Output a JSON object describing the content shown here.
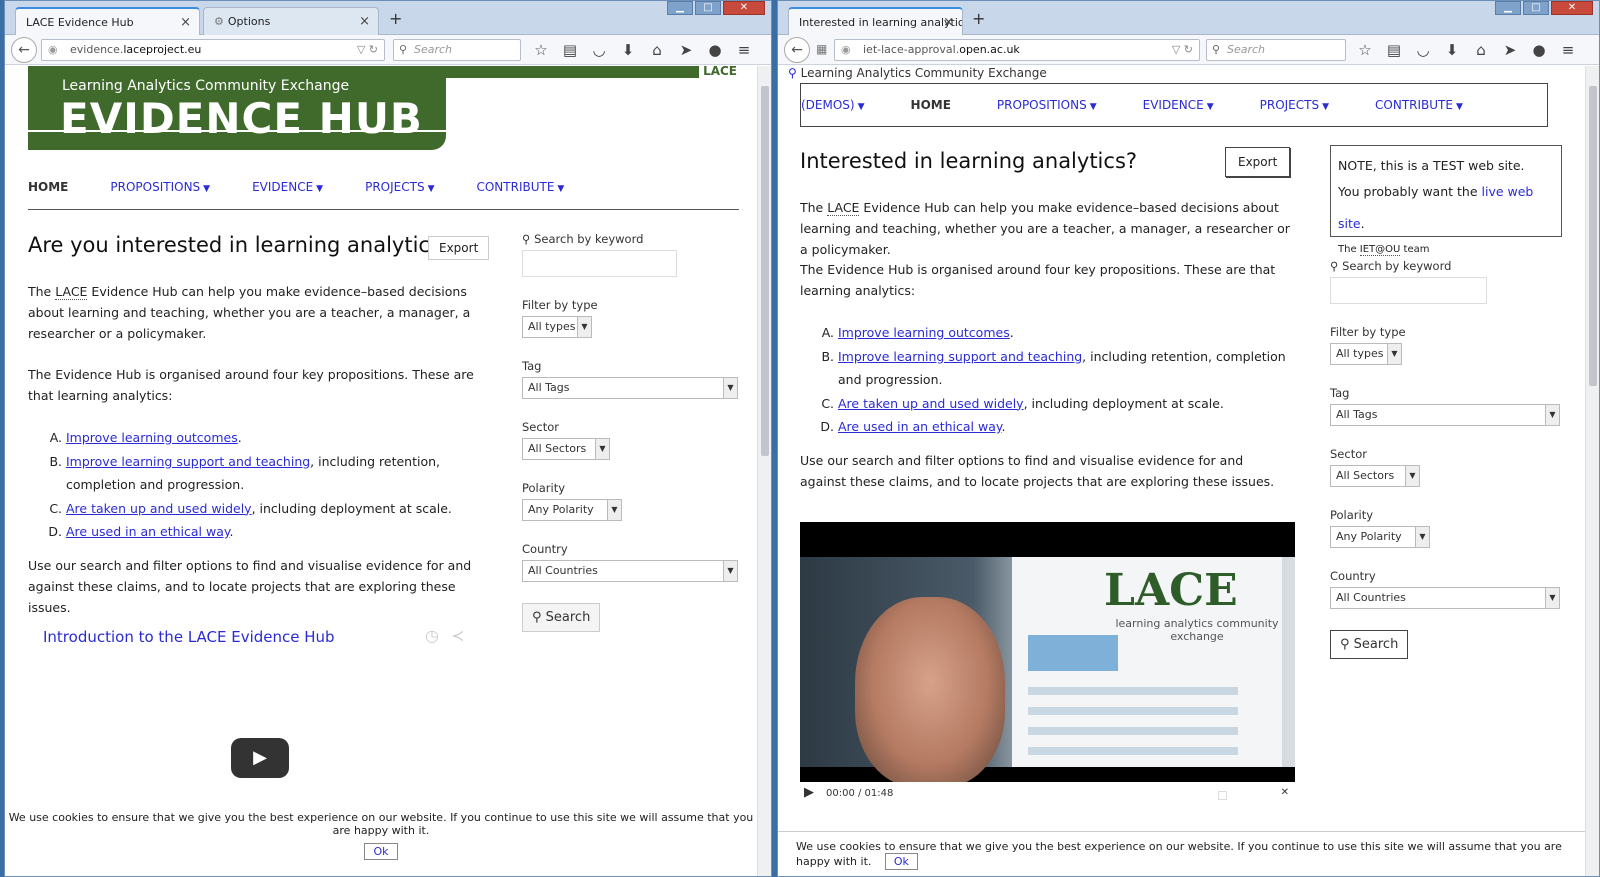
{
  "left": {
    "tabs": [
      {
        "label": "LACE Evidence Hub"
      },
      {
        "label": "Options"
      }
    ],
    "url": {
      "prefix": "evidence.",
      "domain": "laceproject.eu"
    },
    "search_placeholder": "Search",
    "logo": {
      "small": "Learning Analytics Community Exchange",
      "big": "EVIDENCE HUB",
      "mark": "LACE"
    },
    "nav": {
      "home": "HOME",
      "propositions": "PROPOSITIONS",
      "evidence": "EVIDENCE",
      "projects": "PROJECTS",
      "contribute": "CONTRIBUTE"
    },
    "title": "Are you interested in learning analytics?",
    "export": "Export",
    "intro": {
      "before": "The ",
      "abbr": "LACE",
      "after": " Evidence Hub can help you make evidence–based decisions about learning and teaching, whether you are a teacher, a manager, a researcher or a policymaker."
    },
    "organised": "The Evidence Hub is organised around four key propositions. These are that learning analytics:",
    "props": [
      {
        "link": "Improve learning outcomes",
        "rest": "."
      },
      {
        "link": "Improve learning support and teaching",
        "rest": ", including retention, completion and progression."
      },
      {
        "link": "Are taken up and used widely",
        "rest": ", including deployment at scale."
      },
      {
        "link": "Are used in an ethical way",
        "rest": "."
      }
    ],
    "use": "Use our search and filter options to find and visualise evidence for and against these claims, and to locate projects that are exploring these issues.",
    "sidebar": {
      "keyword": "Search by keyword",
      "filter_label": "Filter by type",
      "filter_value": "All types",
      "tag_label": "Tag",
      "tag_value": "All Tags",
      "sector_label": "Sector",
      "sector_value": "All Sectors",
      "polarity_label": "Polarity",
      "polarity_value": "Any Polarity",
      "country_label": "Country",
      "country_value": "All Countries",
      "search_btn": "Search"
    },
    "video_title": "Introduction to the LACE Evidence Hub",
    "cookie": "We use cookies to ensure that we give you the best experience on our website. If you continue to use this site we will assume that you are happy with it.",
    "ok": "Ok"
  },
  "right": {
    "tab": "Interested in learning analytics?...",
    "url": {
      "prefix": "iet-lace-approval.",
      "domain": "open.ac.uk"
    },
    "search_placeholder": "Search",
    "site_tag": "Learning Analytics Community Exchange",
    "nav": {
      "demos": "(DEMOS)",
      "home": "HOME",
      "propositions": "PROPOSITIONS",
      "evidence": "EVIDENCE",
      "projects": "PROJECTS",
      "contribute": "CONTRIBUTE"
    },
    "title": "Interested in learning analytics?",
    "export": "Export",
    "intro": {
      "before": "The ",
      "abbr": "LACE",
      "after": " Evidence Hub can help you make evidence–based decisions about learning and teaching, whether you are a teacher, a manager, a researcher or a policymaker."
    },
    "organised": "The Evidence Hub is organised around four key propositions. These are that learning analytics:",
    "props": [
      {
        "link": "Improve learning outcomes",
        "rest": "."
      },
      {
        "link": "Improve learning support and teaching",
        "rest": ", including retention, completion and progression."
      },
      {
        "link": "Are taken up and used widely",
        "rest": ", including deployment at scale."
      },
      {
        "link": "Are used in an ethical way",
        "rest": "."
      }
    ],
    "use": "Use our search and filter options to find and visualise evidence for and against these claims, and to locate projects that are exploring these issues.",
    "note": {
      "line1": "NOTE, this is a TEST web site.",
      "line2_before": "You probably want the ",
      "line2_link": "live web site",
      "line2_after": ".",
      "line3_before": "The ",
      "line3_abbr": "IET@OU",
      "line3_after": " team"
    },
    "sidebar": {
      "keyword": "Search by keyword",
      "filter_label": "Filter by type",
      "filter_value": "All types",
      "tag_label": "Tag",
      "tag_value": "All Tags",
      "sector_label": "Sector",
      "sector_value": "All Sectors",
      "polarity_label": "Polarity",
      "polarity_value": "Any Polarity",
      "country_label": "Country",
      "country_value": "All Countries",
      "search_btn": "Search"
    },
    "video": {
      "time": "00:00 / 01:48",
      "banner_title": "LACE",
      "banner_sub": "learning analytics\ncommunity exchange"
    },
    "cookie": "We use cookies to ensure that we give you the best experience on our website. If you continue to use this site we will assume that you are happy with it.",
    "ok": "Ok"
  }
}
